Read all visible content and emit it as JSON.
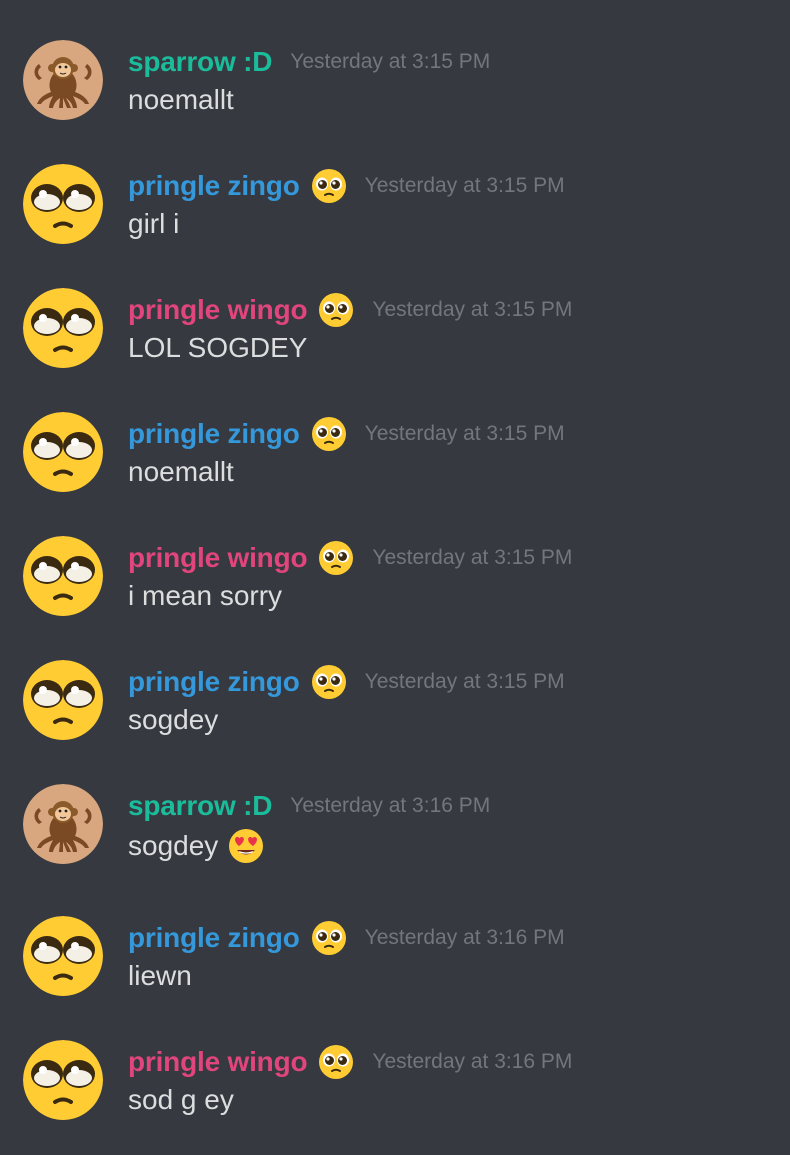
{
  "colors": {
    "background": "#36393f",
    "sparrow": "#1abc9c",
    "zingo": "#3498db",
    "wingo": "#e0457b",
    "timestamp": "#72767d",
    "text": "#dcddde"
  },
  "messages": [
    {
      "user": "sparrow :D",
      "avatar": "monkey-octopus-icon",
      "name_emoji": "",
      "time": "Yesterday at 3:15 PM",
      "text": "noemallt",
      "inline_emoji": ""
    },
    {
      "user": "pringle zingo",
      "avatar": "pleading-face-icon",
      "name_emoji": "pleading-face-icon",
      "time": "Yesterday at 3:15 PM",
      "text": "girl i",
      "inline_emoji": ""
    },
    {
      "user": "pringle wingo",
      "avatar": "pleading-face-icon",
      "name_emoji": "pleading-face-icon",
      "time": "Yesterday at 3:15 PM",
      "text": "LOL SOGDEY",
      "inline_emoji": ""
    },
    {
      "user": "pringle zingo",
      "avatar": "pleading-face-icon",
      "name_emoji": "pleading-face-icon",
      "time": "Yesterday at 3:15 PM",
      "text": "noemallt",
      "inline_emoji": ""
    },
    {
      "user": "pringle wingo",
      "avatar": "pleading-face-icon",
      "name_emoji": "pleading-face-icon",
      "time": "Yesterday at 3:15 PM",
      "text": "i mean sorry",
      "inline_emoji": ""
    },
    {
      "user": "pringle zingo",
      "avatar": "pleading-face-icon",
      "name_emoji": "pleading-face-icon",
      "time": "Yesterday at 3:15 PM",
      "text": "sogdey",
      "inline_emoji": ""
    },
    {
      "user": "sparrow :D",
      "avatar": "monkey-octopus-icon",
      "name_emoji": "",
      "time": "Yesterday at 3:16 PM",
      "text": "sogdey",
      "inline_emoji": "heart-eyes-icon"
    },
    {
      "user": "pringle zingo",
      "avatar": "pleading-face-icon",
      "name_emoji": "pleading-face-icon",
      "time": "Yesterday at 3:16 PM",
      "text": "liewn",
      "inline_emoji": ""
    },
    {
      "user": "pringle wingo",
      "avatar": "pleading-face-icon",
      "name_emoji": "pleading-face-icon",
      "time": "Yesterday at 3:16 PM",
      "text": "sod g ey",
      "inline_emoji": ""
    }
  ]
}
